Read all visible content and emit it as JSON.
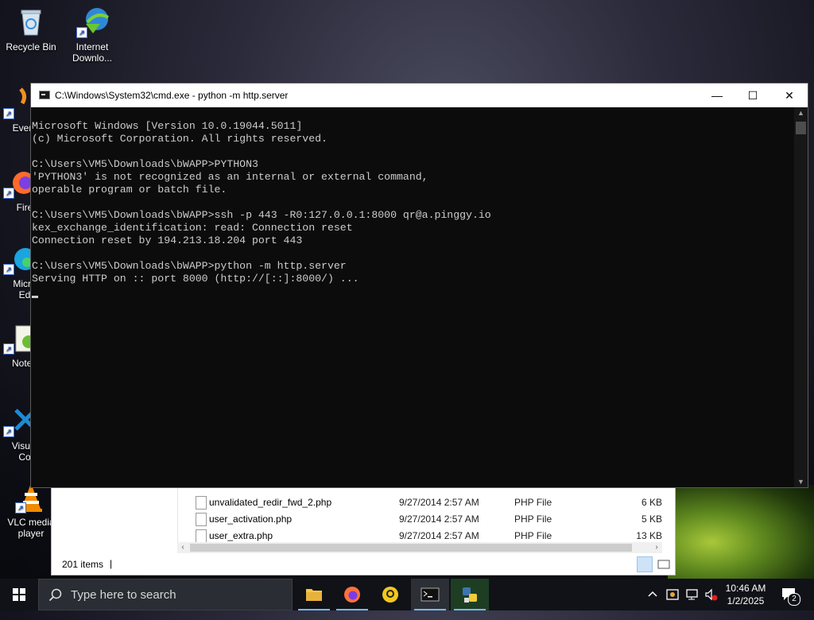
{
  "desktop_icons": {
    "recycle_bin": "Recycle Bin",
    "idm_line1": "Internet",
    "idm_line2": "Downlo...",
    "everything": "Every",
    "firefox": "Fire",
    "edge_line1": "Micro",
    "edge_line2": "Ed",
    "notepad": "Notep",
    "vscode_line1": "Visual",
    "vscode_line2": "Co",
    "vlc_line1": "VLC media",
    "vlc_line2": "player"
  },
  "cmd_window": {
    "title": "C:\\Windows\\System32\\cmd.exe - python  -m http.server",
    "minimize": "—",
    "maximize": "☐",
    "close": "✕",
    "lines": [
      "Microsoft Windows [Version 10.0.19044.5011]",
      "(c) Microsoft Corporation. All rights reserved.",
      "",
      "C:\\Users\\VM5\\Downloads\\bWAPP>PYTHON3",
      "'PYTHON3' is not recognized as an internal or external command,",
      "operable program or batch file.",
      "",
      "C:\\Users\\VM5\\Downloads\\bWAPP>ssh -p 443 -R0:127.0.0.1:8000 qr@a.pinggy.io",
      "kex_exchange_identification: read: Connection reset",
      "Connection reset by 194.213.18.204 port 443",
      "",
      "C:\\Users\\VM5\\Downloads\\bWAPP>python -m http.server",
      "Serving HTTP on :: port 8000 (http://[::]:8000/) ..."
    ]
  },
  "explorer": {
    "files": [
      {
        "name": "unvalidated_redir_fwd_2.php",
        "date": "9/27/2014 2:57 AM",
        "type": "PHP File",
        "size": "6 KB"
      },
      {
        "name": "user_activation.php",
        "date": "9/27/2014 2:57 AM",
        "type": "PHP File",
        "size": "5 KB"
      },
      {
        "name": "user_extra.php",
        "date": "9/27/2014 2:57 AM",
        "type": "PHP File",
        "size": "13 KB"
      }
    ],
    "item_count": "201 items",
    "status_separator": "|"
  },
  "taskbar": {
    "search_placeholder": "Type here to search",
    "time": "10:46 AM",
    "date": "1/2/2025",
    "notification_count": "2",
    "apps": [
      "file-explorer",
      "firefox",
      "app-3",
      "command-prompt",
      "python-idle"
    ]
  },
  "colors": {
    "console_bg": "#0c0c0c",
    "console_text": "#cccccc",
    "taskbar_bg": "#101218",
    "accent": "#76b9ed"
  }
}
